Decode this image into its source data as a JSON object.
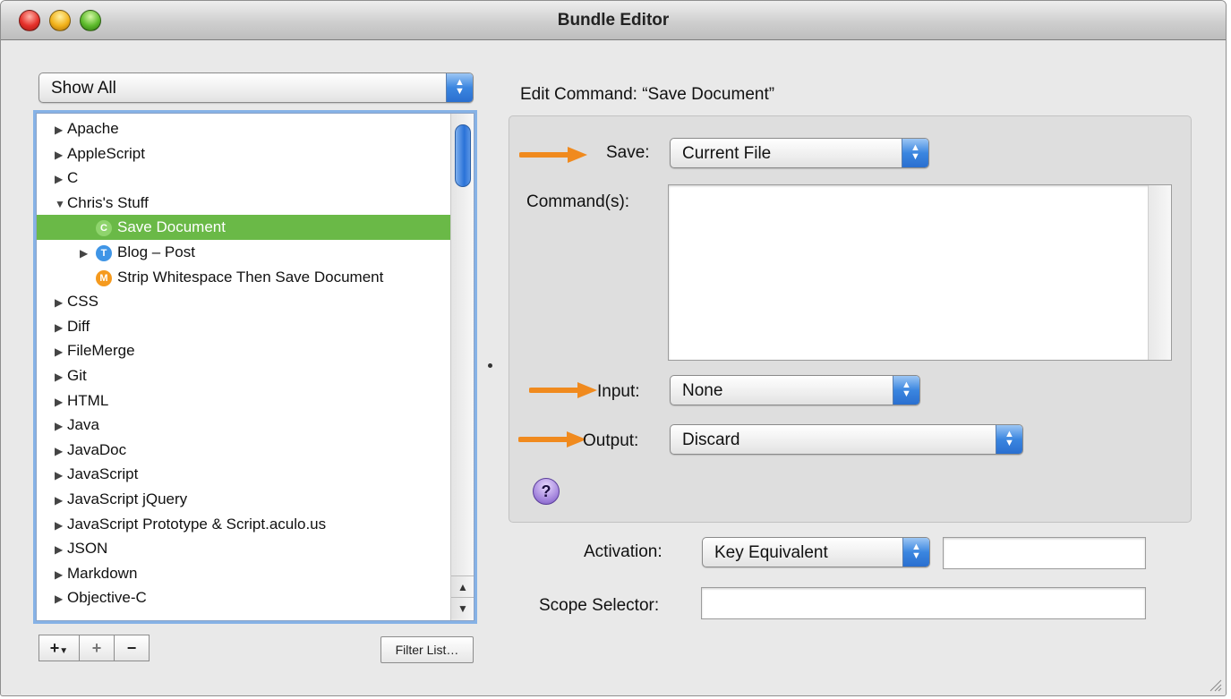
{
  "window": {
    "title": "Bundle Editor"
  },
  "filter_popup": {
    "value": "Show All"
  },
  "bundle_list": {
    "items": [
      {
        "label": "Apache",
        "expanded": false,
        "level": 0
      },
      {
        "label": "AppleScript",
        "expanded": false,
        "level": 0
      },
      {
        "label": "C",
        "expanded": false,
        "level": 0
      },
      {
        "label": "Chris's Stuff",
        "expanded": true,
        "level": 0
      },
      {
        "label": "Save Document",
        "level": 1,
        "badge": "C",
        "badge_color": "#8fd46d",
        "selected": true
      },
      {
        "label": "Blog – Post",
        "level": 1,
        "badge": "T",
        "badge_color": "#3f95e6",
        "has_children": true
      },
      {
        "label": "Strip Whitespace Then Save Document",
        "level": 1,
        "badge": "M",
        "badge_color": "#f59a1e"
      },
      {
        "label": "CSS",
        "expanded": false,
        "level": 0
      },
      {
        "label": "Diff",
        "expanded": false,
        "level": 0
      },
      {
        "label": "FileMerge",
        "expanded": false,
        "level": 0
      },
      {
        "label": "Git",
        "expanded": false,
        "level": 0
      },
      {
        "label": "HTML",
        "expanded": false,
        "level": 0
      },
      {
        "label": "Java",
        "expanded": false,
        "level": 0
      },
      {
        "label": "JavaDoc",
        "expanded": false,
        "level": 0
      },
      {
        "label": "JavaScript",
        "expanded": false,
        "level": 0
      },
      {
        "label": "JavaScript jQuery",
        "expanded": false,
        "level": 0
      },
      {
        "label": "JavaScript Prototype & Script.aculo.us",
        "expanded": false,
        "level": 0
      },
      {
        "label": "JSON",
        "expanded": false,
        "level": 0
      },
      {
        "label": "Markdown",
        "expanded": false,
        "level": 0
      },
      {
        "label": "Objective-C",
        "expanded": false,
        "level": 0
      }
    ]
  },
  "bottom_buttons": {
    "add": "+",
    "add_group": "+",
    "remove": "−",
    "filter": "Filter List…"
  },
  "editor": {
    "heading": "Edit Command: “Save Document”",
    "save_label": "Save:",
    "save_value": "Current File",
    "commands_label": "Command(s):",
    "commands_value": "",
    "input_label": "Input:",
    "input_value": "None",
    "output_label": "Output:",
    "output_value": "Discard",
    "help": "?",
    "activation_label": "Activation:",
    "activation_value": "Key Equivalent",
    "key_equivalent_value": "",
    "scope_label": "Scope Selector:",
    "scope_value": ""
  },
  "colors": {
    "selection": "#6ab947",
    "arrow": "#f08a1e",
    "stepper": "#3b86e0"
  }
}
